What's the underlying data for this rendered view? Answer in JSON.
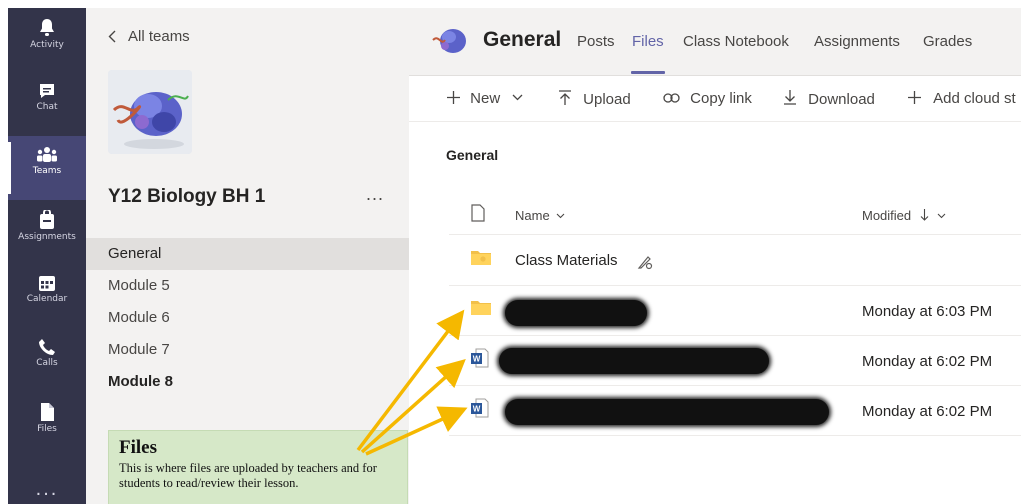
{
  "app_bar": {
    "items": [
      {
        "label": "Activity",
        "icon": "bell-icon"
      },
      {
        "label": "Chat",
        "icon": "chat-icon"
      },
      {
        "label": "Teams",
        "icon": "teams-icon",
        "active": true
      },
      {
        "label": "Assignments",
        "icon": "assignments-icon"
      },
      {
        "label": "Calendar",
        "icon": "calendar-icon"
      },
      {
        "label": "Calls",
        "icon": "phone-icon"
      },
      {
        "label": "Files",
        "icon": "file-icon"
      }
    ],
    "more": "..."
  },
  "team_panel": {
    "back_label": "All teams",
    "team_name": "Y12 Biology BH 1",
    "more": "...",
    "channels": [
      "General",
      "Module 5",
      "Module 6",
      "Module 7",
      "Module 8"
    ],
    "selected_channel": "General",
    "bold_channel": "Module 8"
  },
  "note": {
    "title": "Files",
    "body": "This is where files are uploaded by teachers and for students to read/review their lesson."
  },
  "header": {
    "channel_title": "General",
    "tabs": [
      "Posts",
      "Files",
      "Class Notebook",
      "Assignments",
      "Grades"
    ],
    "active_tab": "Files"
  },
  "toolbar": {
    "new": "New",
    "upload": "Upload",
    "copy_link": "Copy link",
    "download": "Download",
    "add_cloud": "Add cloud st"
  },
  "breadcrumb": "General",
  "columns": {
    "name": "Name",
    "modified": "Modified"
  },
  "files": [
    {
      "type": "folder-special",
      "name": "Class Materials",
      "modified": ""
    },
    {
      "type": "folder",
      "name": "",
      "modified": "Monday at 6:03 PM",
      "redacted": true
    },
    {
      "type": "word",
      "name": "",
      "modified": "Monday at 6:02 PM",
      "redacted": true
    },
    {
      "type": "word",
      "name": "",
      "modified": "Monday at 6:02 PM",
      "redacted": true
    }
  ],
  "colors": {
    "app_bar": "#33344a",
    "accent": "#6264a7",
    "panel_bg": "#f3f2f1",
    "note_bg": "#d6e8c8",
    "arrow": "#f5b800"
  }
}
